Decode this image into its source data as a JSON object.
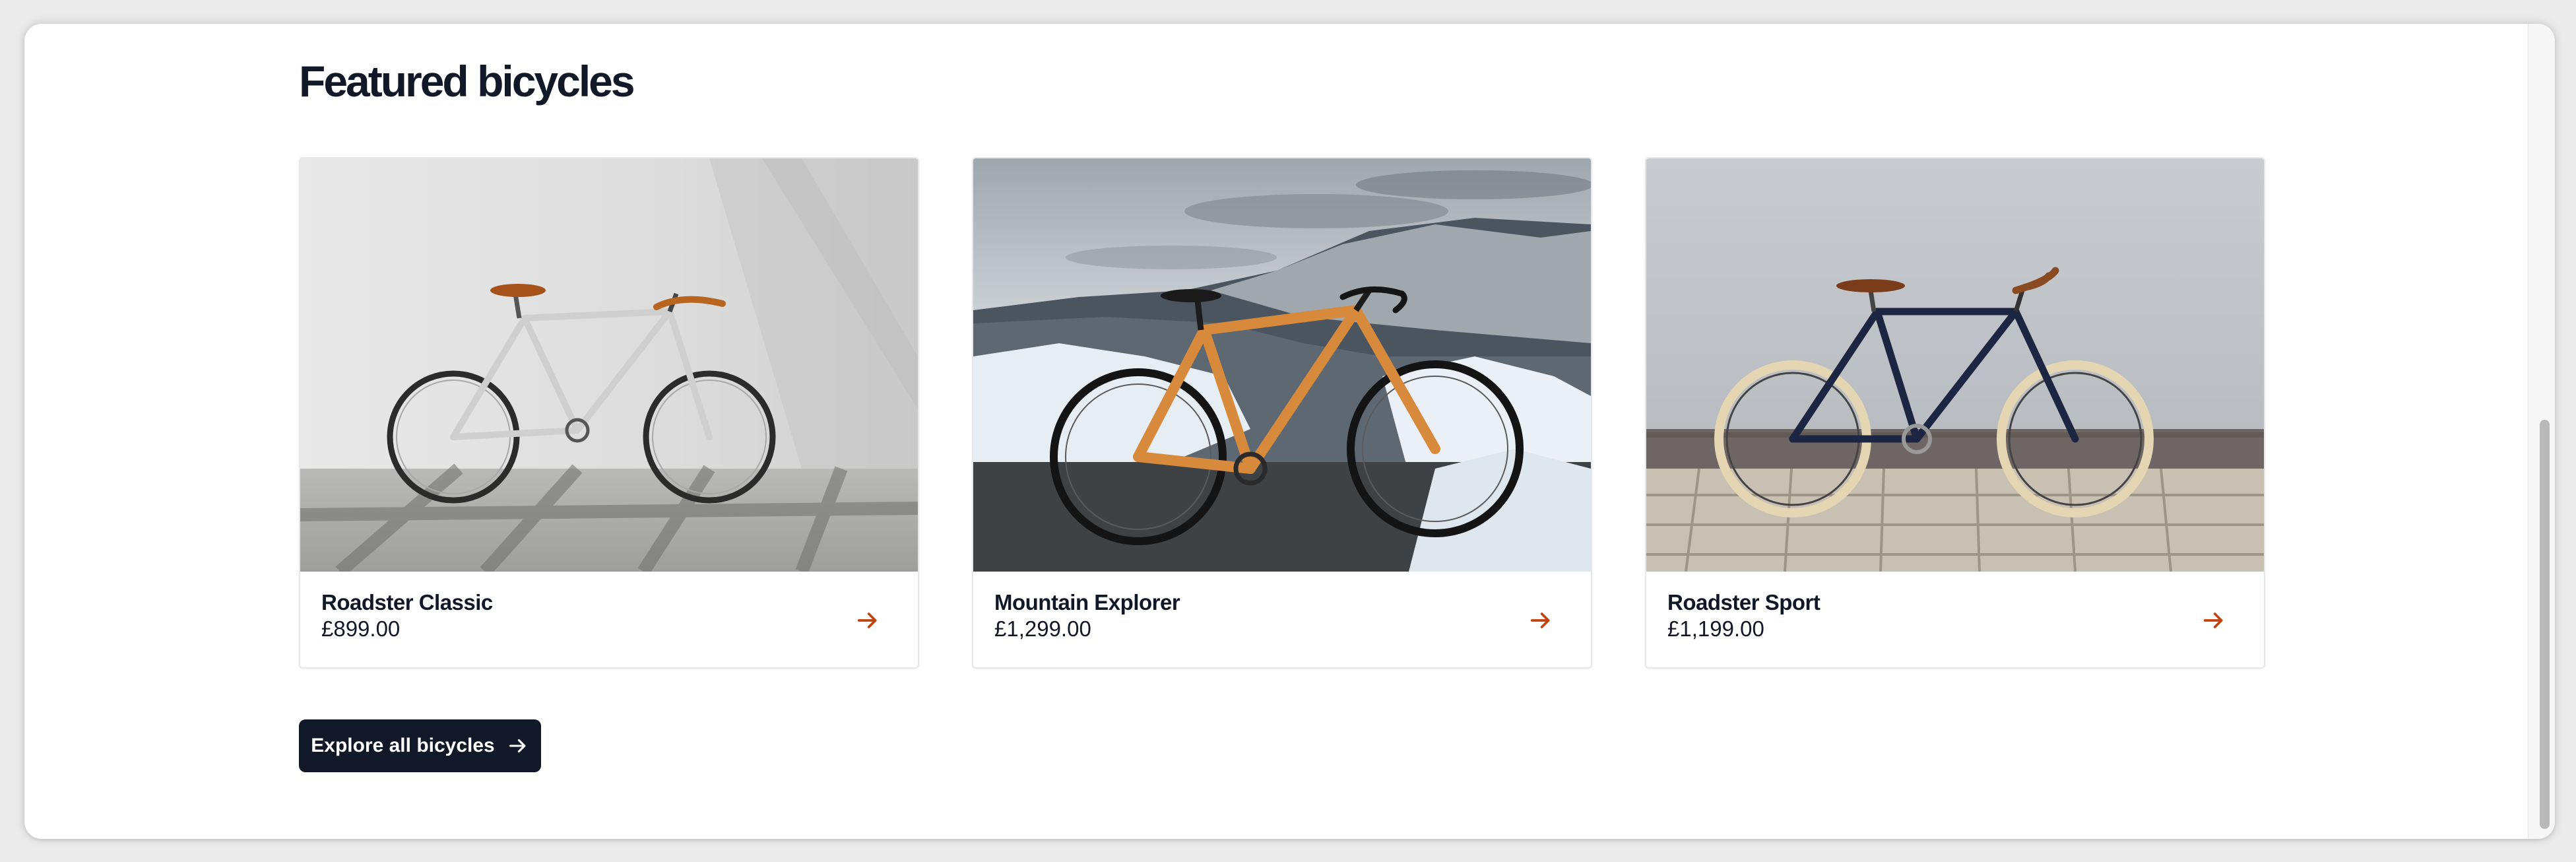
{
  "section": {
    "title": "Featured bicycles"
  },
  "products": [
    {
      "name": "Roadster Classic",
      "price": "£899.00",
      "icon": "arrow-right-icon"
    },
    {
      "name": "Mountain Explorer",
      "price": "£1,299.00",
      "icon": "arrow-right-icon"
    },
    {
      "name": "Roadster Sport",
      "price": "£1,199.00",
      "icon": "arrow-right-icon"
    }
  ],
  "cta": {
    "label": "Explore all bicycles",
    "icon": "arrow-right-icon"
  },
  "colors": {
    "heading": "#111827",
    "accent_arrow": "#c2410c",
    "button_bg": "#111827",
    "button_text": "#ffffff",
    "card_border": "#e5e7eb"
  }
}
